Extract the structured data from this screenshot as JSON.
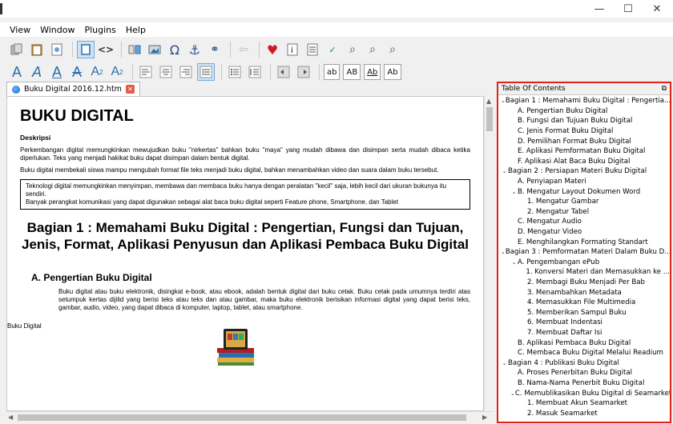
{
  "window": {
    "minimize": "—",
    "maximize": "☐",
    "close": "✕"
  },
  "menu": [
    "View",
    "Window",
    "Plugins",
    "Help"
  ],
  "format_buttons": [
    "ab",
    "AB",
    "Ab",
    "Ab"
  ],
  "tab": {
    "title": "Buku Digital 2016.12.htm"
  },
  "document": {
    "title": "BUKU DIGITAL",
    "desc_heading": "Deskripsi",
    "para1": "Perkembangan digital memungkinkan mewujudkan buku \"nirkertas\" bahkan buku \"maya\" yang mudah dibawa dan disimpan serta mudah dibaca ketika diperlukan. Teks yang menjadi hakikat buku dapat disimpan dalam bentuk digital.",
    "para2": "Buku digital membekali siswa mampu mengubah format file teks menjadi buku digital, bahkan menambahkan video dan suara dalam buku tersebut.",
    "box_line1": "Teknologi digital memungkinkan menyimpan, membawa dan membaca buku hanya dengan peralatan \"kecil\" saja, lebih kecil dari ukuran bukunya itu sendiri.",
    "box_line2": "Banyak perangkat komunikasi yang dapat digunakan sebagai alat baca buku digital seperti Feature phone, Smartphone, dan Tablet",
    "section_title": "Bagian 1 : Memahami Buku Digital : Pengertian, Fungsi dan Tujuan, Jenis, Format, Aplikasi Penyusun dan Aplikasi Pembaca Buku Digital",
    "subsection_title": "A. Pengertian Buku Digital",
    "para3": "Buku digital atau buku elektronik, disingkat e-book, atau ebook, adalah bentuk digital dari buku cetak. Buku cetak pada umumnya terdiri atas setumpuk kertas dijilid yang berisi teks atau teks dan atau gambar, maka buku elektronik berisikan informasi digital yang dapat berisi teks, gambar, audio, video, yang dapat dibaca di komputer, laptop, tablet, atau smartphone.",
    "footer": "Buku Digital"
  },
  "toc": {
    "title": "Table Of Contents",
    "items": [
      {
        "level": 0,
        "expanded": true,
        "label": "Bagian 1 : Memahami Buku Digital : Pengertia..."
      },
      {
        "level": 1,
        "label": "A. Pengertian Buku Digital"
      },
      {
        "level": 1,
        "label": "B. Fungsi dan Tujuan Buku Digital"
      },
      {
        "level": 1,
        "label": "C. Jenis Format Buku Digital"
      },
      {
        "level": 1,
        "label": "D. Pemilihan Format Buku Digital"
      },
      {
        "level": 1,
        "label": "E. Aplikasi Pemformatan Buku Digital"
      },
      {
        "level": 1,
        "label": "F. Aplikasi Alat Baca Buku Digital"
      },
      {
        "level": 0,
        "expanded": true,
        "label": "Bagian 2 : Persiapan Materi Buku Digital"
      },
      {
        "level": 1,
        "label": "A. Penyiapan Materi"
      },
      {
        "level": 1,
        "expanded": true,
        "label": "B. Mengatur Layout Dokumen Word"
      },
      {
        "level": 2,
        "label": "1. Mengatur Gambar"
      },
      {
        "level": 2,
        "label": "2. Mengatur Tabel"
      },
      {
        "level": 1,
        "label": "C. Mengatur Audio"
      },
      {
        "level": 1,
        "label": "D. Mengatur Video"
      },
      {
        "level": 1,
        "label": "E. Menghilangkan Formating Standart"
      },
      {
        "level": 0,
        "expanded": true,
        "label": "Bagian 3 : Pemformatan Materi Dalam Buku D..."
      },
      {
        "level": 1,
        "expanded": true,
        "label": "A. Pengembangan ePub"
      },
      {
        "level": 2,
        "label": "1. Konversi Materi dan Memasukkan ke ..."
      },
      {
        "level": 2,
        "label": "2. Membagi Buku Menjadi Per Bab"
      },
      {
        "level": 2,
        "label": "3. Menambahkan Metadata"
      },
      {
        "level": 2,
        "label": "4. Memasukkan File Multimedia"
      },
      {
        "level": 2,
        "label": "5. Memberikan Sampul Buku"
      },
      {
        "level": 2,
        "label": "6. Membuat Indentasi"
      },
      {
        "level": 2,
        "label": "7. Membuat Daftar Isi"
      },
      {
        "level": 1,
        "label": "B. Aplikasi Pembaca Buku Digital"
      },
      {
        "level": 1,
        "label": "C. Membaca Buku Digital Melalui Readium"
      },
      {
        "level": 0,
        "expanded": true,
        "label": "Bagian 4 : Publikasi Buku Digital"
      },
      {
        "level": 1,
        "label": "A. Proses Penerbitan Buku Digital"
      },
      {
        "level": 1,
        "label": "B. Nama-Nama Penerbit Buku Digital"
      },
      {
        "level": 1,
        "expanded": true,
        "label": "C. Memublikasikan Buku Digital di Seamarket"
      },
      {
        "level": 2,
        "label": "1. Membuat Akun Seamarket"
      },
      {
        "level": 2,
        "label": "2. Masuk Seamarket"
      }
    ]
  },
  "colors": {
    "toc_border": "#e0221a",
    "active_button": "#cde4f7"
  }
}
